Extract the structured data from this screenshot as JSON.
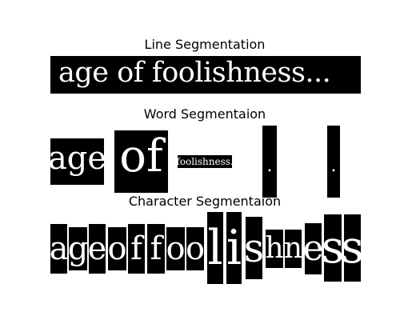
{
  "headings": {
    "line": "Line Segmentation",
    "word": "Word Segmentaion",
    "character": "Character Segmentaion"
  },
  "line_text": "age of foolishness...",
  "words": [
    "age",
    "of",
    "foolishness.",
    ".",
    "."
  ],
  "characters": [
    "a",
    "g",
    "e",
    "o",
    "f",
    "f",
    "o",
    "o",
    "l",
    "i",
    "s",
    "h",
    "n",
    "e",
    "s",
    "s"
  ],
  "colors": {
    "background": "#ffffff",
    "box": "#000000",
    "text": "#ffffff"
  }
}
